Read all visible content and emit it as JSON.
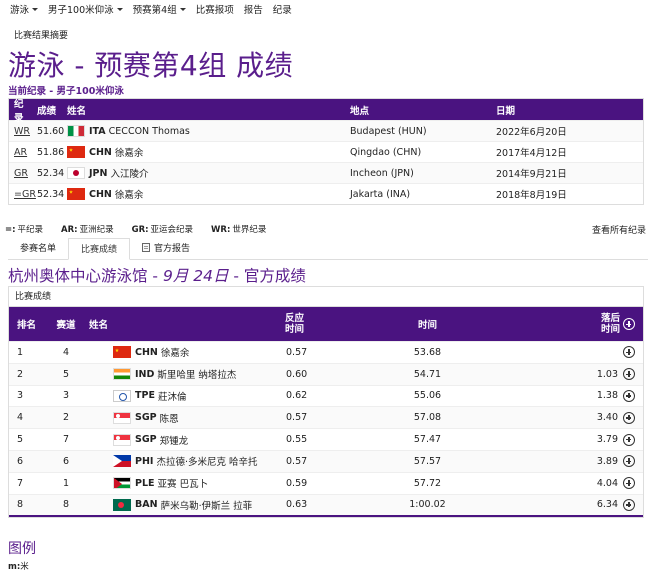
{
  "nav": {
    "items": [
      {
        "label": "游泳",
        "caret": true
      },
      {
        "label": "男子100米仰泳",
        "caret": true
      },
      {
        "label": "预赛第4组",
        "caret": true
      },
      {
        "label": "比赛报项",
        "caret": false
      },
      {
        "label": "报告",
        "caret": false
      },
      {
        "label": "纪录",
        "caret": false
      }
    ]
  },
  "summary_link": "比赛结果摘要",
  "page_title": "游泳 - 预赛第4组 成绩",
  "current_record_label": "当前纪录 - 男子100米仰泳",
  "records": {
    "headers": {
      "type": "纪录",
      "result": "成绩",
      "name": "姓名",
      "location": "地点",
      "date": "日期"
    },
    "rows": [
      {
        "type": "WR",
        "result": "51.60",
        "flag": "ita",
        "noc": "ITA",
        "name": "CECCON Thomas",
        "location": "Budapest (HUN)",
        "date": "2022年6月20日"
      },
      {
        "type": "AR",
        "result": "51.86",
        "flag": "chn",
        "noc": "CHN",
        "name": "徐嘉余",
        "location": "Qingdao (CHN)",
        "date": "2017年4月12日"
      },
      {
        "type": "GR",
        "result": "52.34",
        "flag": "jpn",
        "noc": "JPN",
        "name": "入江陵介",
        "location": "Incheon (JPN)",
        "date": "2014年9月21日"
      },
      {
        "type": "=GR",
        "result": "52.34",
        "flag": "chn",
        "noc": "CHN",
        "name": "徐嘉余",
        "location": "Jakarta (INA)",
        "date": "2018年8月19日"
      }
    ]
  },
  "record_legend": [
    {
      "code": "=:",
      "text": "平纪录"
    },
    {
      "code": "AR:",
      "text": "亚洲纪录"
    },
    {
      "code": "GR:",
      "text": "亚运会纪录"
    },
    {
      "code": "WR:",
      "text": "世界纪录"
    }
  ],
  "view_all_records": "查看所有纪录",
  "tabs": [
    {
      "label": "参赛名单",
      "active": false
    },
    {
      "label": "比赛成绩",
      "active": true
    },
    {
      "label": "官方报告",
      "active": false
    }
  ],
  "venue": {
    "name": "杭州奥体中心游泳馆 - ",
    "date": "9月 24日",
    "status": " - 官方成绩"
  },
  "results": {
    "subtitle": "比赛成绩",
    "headers": {
      "rank": "排名",
      "lane": "赛道",
      "name": "姓名",
      "reaction_1": "反应",
      "reaction_2": "时间",
      "time": "时间",
      "behind_1": "落后",
      "behind_2": "时间"
    },
    "rows": [
      {
        "rank": "1",
        "lane": "4",
        "flag": "chn",
        "noc": "CHN",
        "name": "徐嘉余",
        "reaction": "0.57",
        "time": "53.68",
        "behind": ""
      },
      {
        "rank": "2",
        "lane": "5",
        "flag": "ind",
        "noc": "IND",
        "name": "斯里哈里 纳塔拉杰",
        "reaction": "0.60",
        "time": "54.71",
        "behind": "1.03"
      },
      {
        "rank": "3",
        "lane": "3",
        "flag": "tpe",
        "noc": "TPE",
        "name": "莊沐倫",
        "reaction": "0.62",
        "time": "55.06",
        "behind": "1.38"
      },
      {
        "rank": "4",
        "lane": "2",
        "flag": "sgp",
        "noc": "SGP",
        "name": "陈恩",
        "reaction": "0.57",
        "time": "57.08",
        "behind": "3.40"
      },
      {
        "rank": "5",
        "lane": "7",
        "flag": "sgp",
        "noc": "SGP",
        "name": "郑锺龙",
        "reaction": "0.55",
        "time": "57.47",
        "behind": "3.79"
      },
      {
        "rank": "6",
        "lane": "6",
        "flag": "phi",
        "noc": "PHI",
        "name": "杰拉德·多米尼克 哈辛托",
        "reaction": "0.57",
        "time": "57.57",
        "behind": "3.89"
      },
      {
        "rank": "7",
        "lane": "1",
        "flag": "ple",
        "noc": "PLE",
        "name": "亚赛 巴瓦卜",
        "reaction": "0.59",
        "time": "57.72",
        "behind": "4.04"
      },
      {
        "rank": "8",
        "lane": "8",
        "flag": "ban",
        "noc": "BAN",
        "name": "萨米乌勒·伊斯兰 拉菲",
        "reaction": "0.63",
        "time": "1:00.02",
        "behind": "6.34"
      }
    ]
  },
  "legend": {
    "title": "图例",
    "m_code": "m:",
    "m_text": "米"
  }
}
